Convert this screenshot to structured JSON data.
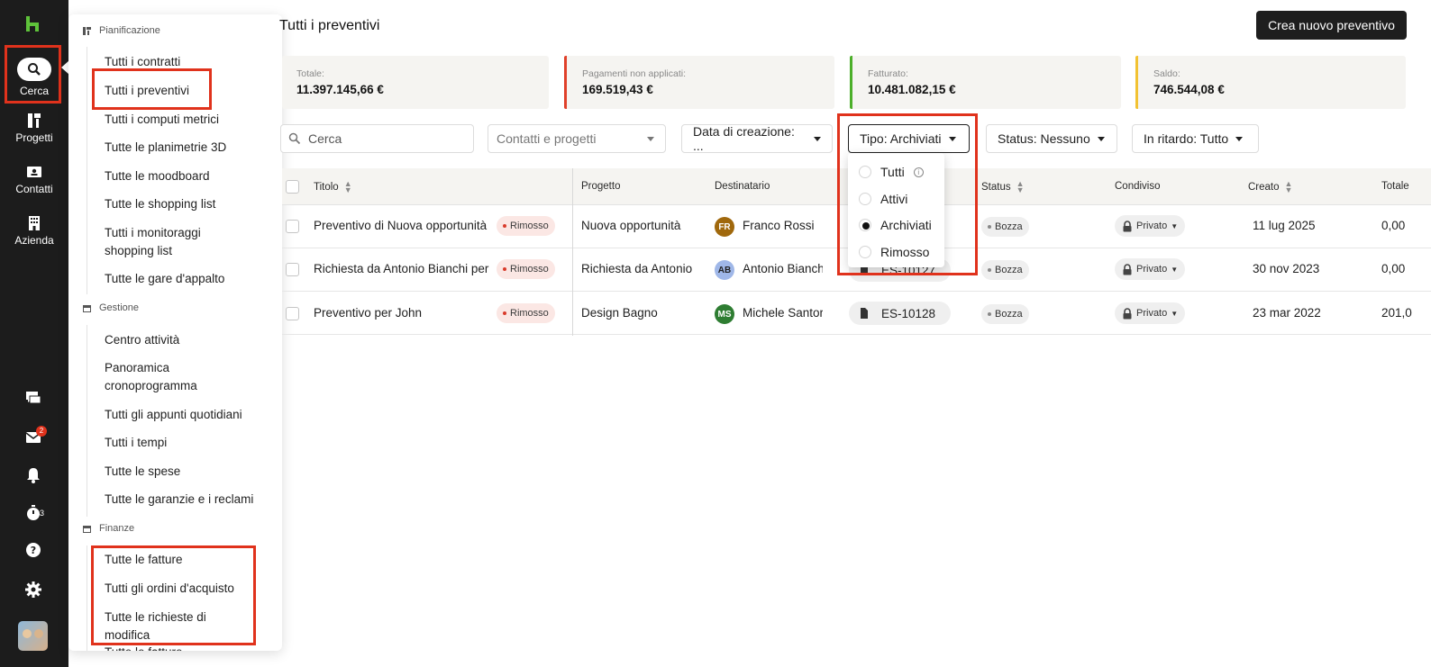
{
  "rail": {
    "items": [
      {
        "label": "Cerca"
      },
      {
        "label": "Progetti"
      },
      {
        "label": "Contatti"
      },
      {
        "label": "Azienda"
      }
    ],
    "inbox_badge": "2",
    "timer_count": "3"
  },
  "flyout": {
    "sections": [
      {
        "title": "Pianificazione"
      },
      {
        "title": "Gestione"
      },
      {
        "title": "Finanze"
      }
    ],
    "pianificazione_items": [
      "Tutti i contratti",
      "Tutti i preventivi",
      "Tutti i computi metrici",
      "Tutte le planimetrie 3D",
      "Tutte le moodboard",
      "Tutte le shopping list",
      "Tutti i monitoraggi shopping list",
      "Tutte le gare d'appalto"
    ],
    "gestione_items": [
      "Centro attività",
      "Panoramica cronoprogramma",
      "Tutti gli appunti quotidiani",
      "Tutti i tempi",
      "Tutte le spese",
      "Tutte le garanzie e i reclami"
    ],
    "finanze_items": [
      "Tutte le fatture",
      "Tutti gli ordini d'acquisto",
      "Tutte le richieste di modifica",
      "Tutte le fatture"
    ]
  },
  "header": {
    "title": "Tutti i preventivi",
    "create_button": "Crea nuovo preventivo"
  },
  "summary_cards": [
    {
      "label": "Totale:",
      "value": "11.397.145,66 €",
      "accent": ""
    },
    {
      "label": "Pagamenti non applicati:",
      "value": "169.519,43 €",
      "accent": "#e0402a"
    },
    {
      "label": "Fatturato:",
      "value": "10.481.082,15 €",
      "accent": "#4caf2a"
    },
    {
      "label": "Saldo:",
      "value": "746.544,08 €",
      "accent": "#f2c232"
    }
  ],
  "filters": {
    "search_placeholder": "Cerca",
    "contacts_placeholder": "Contatti e progetti",
    "date_label": "Data di creazione: ...",
    "type_label": "Tipo: Archiviati",
    "status_label": "Status: Nessuno",
    "late_label": "In ritardo: Tutto"
  },
  "type_dropdown": {
    "options": [
      "Tutti",
      "Attivi",
      "Archiviati",
      "Rimosso"
    ],
    "selected": "Archiviati"
  },
  "table": {
    "columns": [
      "Titolo",
      "Progetto",
      "Destinatario",
      "Status",
      "Condiviso",
      "Creato",
      "Totale"
    ],
    "rows": [
      {
        "title": "Preventivo di Nuova opportunità",
        "state": "Rimosso",
        "project": "Nuova opportunità",
        "recipient_initials": "FR",
        "recipient": "Franco Rossi",
        "recipient_color": "#a0680c",
        "doc": "",
        "status": "Bozza",
        "shared": "Privato",
        "created": "11 lug 2025",
        "total": "0,00"
      },
      {
        "title": "Richiesta da Antonio Bianchi per",
        "state": "Rimosso",
        "project": "Richiesta da Antonio",
        "recipient_initials": "AB",
        "recipient": "Antonio Bianchi",
        "recipient_color": "#9fb7e8",
        "doc": "ES-10127",
        "status": "Bozza",
        "shared": "Privato",
        "created": "30 nov 2023",
        "total": "0,00"
      },
      {
        "title": "Preventivo per John",
        "state": "Rimosso",
        "project": "Design Bagno",
        "recipient_initials": "MS",
        "recipient": "Michele Santoro",
        "recipient_color": "#2e7d32",
        "doc": "ES-10128",
        "status": "Bozza",
        "shared": "Privato",
        "created": "23 mar 2022",
        "total": "201,0"
      }
    ]
  }
}
